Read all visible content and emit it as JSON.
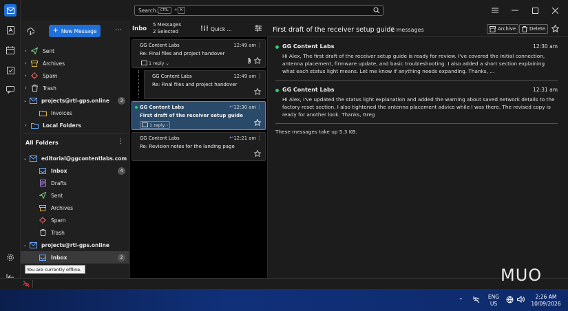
{
  "search": {
    "placeholder": "Search...",
    "kbd1": "CTRL",
    "plus": "+",
    "kbd2": "K"
  },
  "toolbar": {
    "new_message": "New Message"
  },
  "folders": {
    "top": [
      {
        "label": "Sent",
        "icon": "sent-icon"
      },
      {
        "label": "Archives",
        "icon": "archive-folder-icon"
      },
      {
        "label": "Spam",
        "icon": "spam-icon"
      },
      {
        "label": "Trash",
        "icon": "trash-icon"
      },
      {
        "label": "projects@rtl-gps.online",
        "icon": "account-icon",
        "badge": "3"
      },
      {
        "label": "Invoices",
        "icon": "folder-icon"
      },
      {
        "label": "Local Folders",
        "icon": "folder-icon"
      }
    ],
    "all_folders_title": "All Folders",
    "all": [
      {
        "label": "editorial@ggcontentlabs.com",
        "badge": ""
      },
      {
        "label": "Inbox",
        "badge": "4"
      },
      {
        "label": "Drafts"
      },
      {
        "label": "Sent"
      },
      {
        "label": "Archives"
      },
      {
        "label": "Spam"
      },
      {
        "label": "Trash"
      },
      {
        "label": "projects@rtl-gps.online"
      },
      {
        "label": "Inbox",
        "badge": "2"
      }
    ],
    "tooltip": "You are currently offline."
  },
  "list": {
    "title": "Inbo",
    "count1": "5 Messages",
    "count2": "2 Selected",
    "quick": "Quick ...",
    "cards": [
      {
        "from": "GG Content Labs",
        "time": "12:49 am",
        "subject": "Re: Final files and project handover",
        "reply": "1 reply"
      },
      {
        "from": "GG Content Labs",
        "time": "12:49 am",
        "subject": "Re: Final files and project handover"
      },
      {
        "from": "GG Content Labs",
        "time": "12:30 am",
        "subject": "First draft of the receiver setup guide",
        "reply": "1 reply"
      },
      {
        "from": "GG Content Labs",
        "time": "12:21 am",
        "subject": "Re: Revision notes for the landing page"
      }
    ]
  },
  "reader": {
    "title": "First draft of the receiver setup guide",
    "count": "2 messages",
    "archive": "Archive",
    "delete": "Delete",
    "messages": [
      {
        "from": "GG Content Labs",
        "time": "12:30 am",
        "body": "Hi Alex, The first draft of the receiver setup guide is ready for review. I've covered the initial connection, antenna placement, firmware update, and basic troubleshooting. I also added a short section explaining what each status light means. Let me know if anything needs expanding. Thanks, ..."
      },
      {
        "from": "GG Content Labs",
        "time": "12:31 am",
        "body": "Hi Alex, I've updated the status light explanation and added the warning about saved network details to the factory reset section. I also tightened the antenna placement advice while I was there. The revised copy is ready for another look. Thanks, Greg"
      }
    ],
    "footnote": "These messages take up 5.3 KB."
  },
  "taskbar": {
    "lang1": "ENG",
    "lang2": "US",
    "time": "2:26 AM",
    "date": "10/09/2026"
  },
  "watermark": "MUO",
  "colors": {
    "accent": "#1f6fd6",
    "unread_dot": "#2ecc71",
    "selected_card": "#2a4a6a"
  }
}
